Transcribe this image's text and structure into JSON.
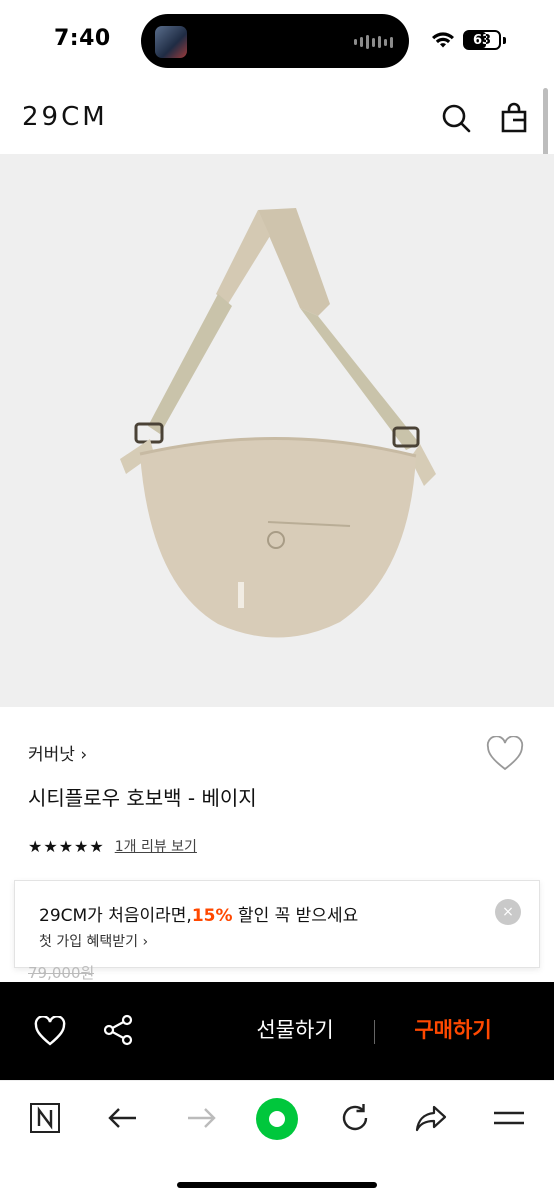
{
  "status": {
    "time": "7:40",
    "battery": "63",
    "battery_level": 0.63
  },
  "header": {
    "logo": "29CM"
  },
  "product": {
    "brand": "커버낫 ›",
    "title": "시티플로우 호보백 - 베이지",
    "rating_stars": "★★★★★",
    "rating_value": 5,
    "review_link": "1개 리뷰 보기",
    "price_partial": "79,000원"
  },
  "promo": {
    "title_prefix": "29CM가 처음이라면,",
    "title_accent": "15%",
    "title_suffix": " 할인 꼭 받으세요",
    "subtitle": "첫 가입 혜택받기 ›",
    "close_icon": "×"
  },
  "buy_bar": {
    "gift_label": "선물하기",
    "purchase_label": "구매하기"
  },
  "colors": {
    "accent": "#ff4800",
    "bar_bg": "#000000",
    "browser_green": "#00c73c",
    "image_bg": "#efefef",
    "bag_beige": "#d8ccb8"
  }
}
